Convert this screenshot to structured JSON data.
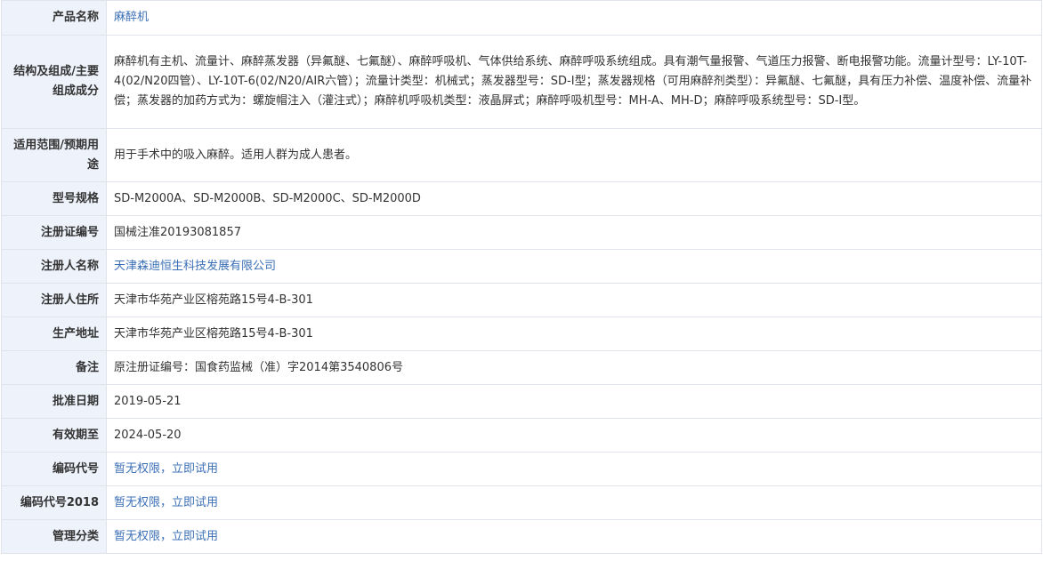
{
  "rows": [
    {
      "label": "产品名称",
      "value": "麻醉机",
      "link": true
    },
    {
      "label": "结构及组成/主要组成成分",
      "value": "麻醉机有主机、流量计、麻醉蒸发器（异氟醚、七氟醚）、麻醉呼吸机、气体供给系统、麻醉呼吸系统组成。具有潮气量报警、气道压力报警、断电报警功能。流量计型号：LY-10T-4(02/N20四管）、LY-10T-6(02/N20/AIR六管）；流量计类型：机械式；蒸发器型号：SD-I型；蒸发器规格（可用麻醉剂类型）：异氟醚、七氟醚，具有压力补偿、温度补偿、流量补偿；蒸发器的加药方式为：螺旋帽注入（灌注式）；麻醉机呼吸机类型：液晶屏式；麻醉呼吸机型号：MH-A、MH-D；麻醉呼吸系统型号：SD-I型。",
      "link": false
    },
    {
      "label": "适用范围/预期用途",
      "value": "用于手术中的吸入麻醉。适用人群为成人患者。",
      "link": false
    },
    {
      "label": "型号规格",
      "value": "SD-M2000A、SD-M2000B、SD-M2000C、SD-M2000D",
      "link": false
    },
    {
      "label": "注册证编号",
      "value": "国械注准20193081857",
      "link": false
    },
    {
      "label": "注册人名称",
      "value": "天津森迪恒生科技发展有限公司",
      "link": true
    },
    {
      "label": "注册人住所",
      "value": "天津市华苑产业区榕苑路15号4-B-301",
      "link": false
    },
    {
      "label": "生产地址",
      "value": "天津市华苑产业区榕苑路15号4-B-301",
      "link": false
    },
    {
      "label": "备注",
      "value": "原注册证编号：国食药监械（准）字2014第3540806号",
      "link": false
    },
    {
      "label": "批准日期",
      "value": "2019-05-21",
      "link": false
    },
    {
      "label": "有效期至",
      "value": "2024-05-20",
      "link": false
    },
    {
      "label": "编码代号",
      "value": "暂无权限，立即试用",
      "link": true
    },
    {
      "label": "编码代号2018",
      "value": "暂无权限，立即试用",
      "link": true
    },
    {
      "label": "管理分类",
      "value": "暂无权限，立即试用",
      "link": true
    }
  ]
}
